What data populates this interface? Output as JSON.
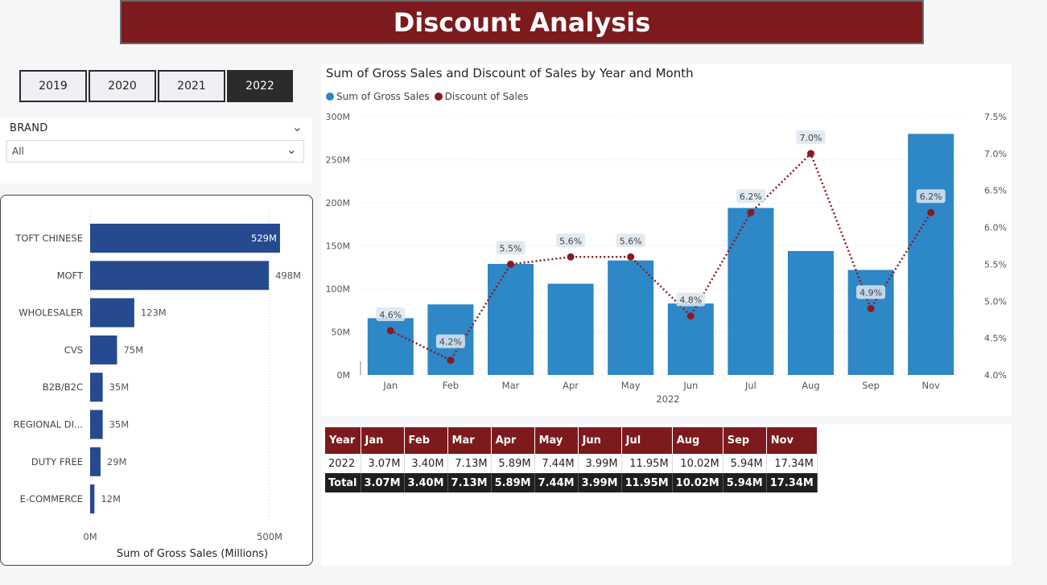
{
  "header": {
    "title": "Discount Analysis"
  },
  "years": [
    {
      "label": "2019",
      "active": false
    },
    {
      "label": "2020",
      "active": false
    },
    {
      "label": "2021",
      "active": false
    },
    {
      "label": "2022",
      "active": true
    }
  ],
  "brand_filter": {
    "label": "BRAND",
    "value": "All"
  },
  "colors": {
    "accent": "#7d1a1d",
    "bar_blue": "#2e87c6",
    "bar_navy": "#264a8f",
    "line_red": "#8b1a1f",
    "dark": "#2b2b2b"
  },
  "chart_data": [
    {
      "type": "bar",
      "orientation": "horizontal",
      "categories": [
        "TOFT CHINESE",
        "MOFT",
        "WHOLESALER",
        "CVS",
        "B2B/B2C",
        "REGIONAL DI...",
        "DUTY FREE",
        "E-COMMERCE"
      ],
      "values": [
        529,
        498,
        123,
        75,
        35,
        35,
        29,
        12
      ],
      "value_labels": [
        "529M",
        "498M",
        "123M",
        "75M",
        "35M",
        "35M",
        "29M",
        "12M"
      ],
      "xlabel": "Sum of Gross Sales (Millions)",
      "xticks": [
        "0M",
        "500M"
      ],
      "xlim": [
        0,
        560
      ]
    },
    {
      "type": "bar+line",
      "title": "Sum of Gross Sales and Discount of Sales by Year and Month",
      "categories": [
        "Jan",
        "Feb",
        "Mar",
        "Apr",
        "May",
        "Jun",
        "Jul",
        "Aug",
        "Sep",
        "Nov"
      ],
      "xlabel": "2022",
      "series": [
        {
          "name": "Sum of Gross Sales",
          "type": "bar",
          "axis": "left",
          "values": [
            66,
            82,
            129,
            106,
            133,
            83,
            194,
            144,
            122,
            280
          ]
        },
        {
          "name": "Discount of Sales",
          "type": "line",
          "axis": "right",
          "values": [
            4.6,
            4.2,
            5.5,
            5.6,
            5.6,
            4.8,
            6.2,
            7.0,
            4.9,
            6.2
          ],
          "labels": [
            "4.6%",
            "4.2%",
            "5.5%",
            "5.6%",
            "5.6%",
            "4.8%",
            "6.2%",
            "7.0%",
            "4.9%",
            "6.2%"
          ]
        }
      ],
      "yleft_ticks": [
        "0M",
        "50M",
        "100M",
        "150M",
        "200M",
        "250M",
        "300M"
      ],
      "yleft_lim": [
        0,
        300
      ],
      "yright_ticks": [
        "4.0%",
        "4.5%",
        "5.0%",
        "5.5%",
        "6.0%",
        "6.5%",
        "7.0%",
        "7.5%"
      ],
      "yright_lim": [
        4.0,
        7.5
      ],
      "legend": "top-left"
    }
  ],
  "table": {
    "columns": [
      "Year",
      "Jan",
      "Feb",
      "Mar",
      "Apr",
      "May",
      "Jun",
      "Jul",
      "Aug",
      "Sep",
      "Nov"
    ],
    "rows": [
      [
        "2022",
        "3.07M",
        "3.40M",
        "7.13M",
        "5.89M",
        "7.44M",
        "3.99M",
        "11.95M",
        "10.02M",
        "5.94M",
        "17.34M"
      ]
    ],
    "total": [
      "Total",
      "3.07M",
      "3.40M",
      "7.13M",
      "5.89M",
      "7.44M",
      "3.99M",
      "11.95M",
      "10.02M",
      "5.94M",
      "17.34M"
    ]
  }
}
